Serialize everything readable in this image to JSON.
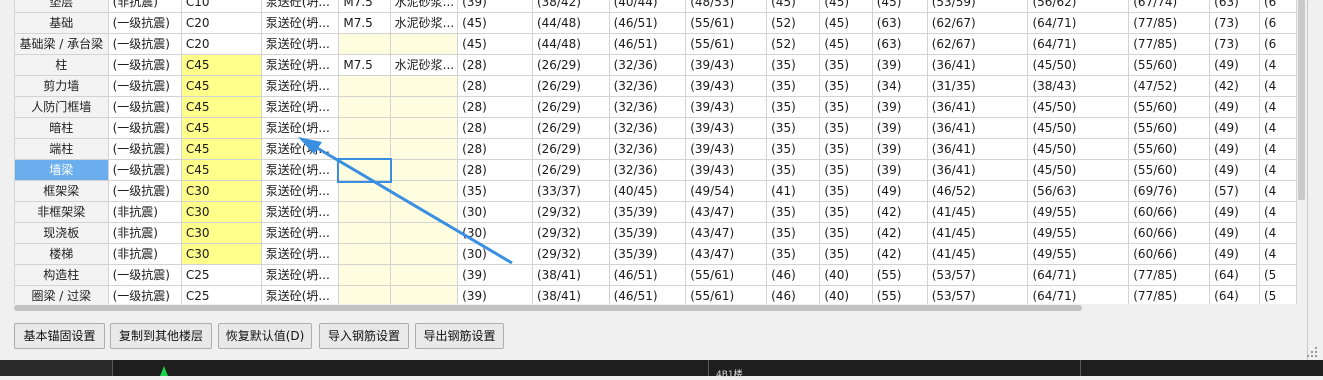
{
  "rows": [
    {
      "name": "垫层",
      "seismic": "(非抗震)",
      "concrete": "C10",
      "pump": "泵送砼(坍...",
      "mortar": "M7.5",
      "mortar_type": "水泥砂浆...",
      "v": [
        "(39)",
        "(38/42)",
        "(40/44)",
        "(48/53)",
        "(45)",
        "(45)",
        "(45)",
        "(53/59)",
        "(56/62)",
        "(67/74)",
        "(63)",
        "(6"
      ]
    },
    {
      "name": "基础",
      "seismic": "(一级抗震)",
      "concrete": "C20",
      "pump": "泵送砼(坍...",
      "mortar": "M7.5",
      "mortar_type": "水泥砂浆...",
      "v": [
        "(45)",
        "(44/48)",
        "(46/51)",
        "(55/61)",
        "(52)",
        "(45)",
        "(63)",
        "(62/67)",
        "(64/71)",
        "(77/85)",
        "(73)",
        "(6"
      ]
    },
    {
      "name": "基础梁 / 承台梁",
      "seismic": "(一级抗震)",
      "concrete": "C20",
      "pump": "泵送砼(坍...",
      "mortar": "",
      "mortar_type": "",
      "v": [
        "(45)",
        "(44/48)",
        "(46/51)",
        "(55/61)",
        "(52)",
        "(45)",
        "(63)",
        "(62/67)",
        "(64/71)",
        "(77/85)",
        "(73)",
        "(6"
      ]
    },
    {
      "name": "柱",
      "seismic": "(一级抗震)",
      "concrete": "C45",
      "pump": "泵送砼(坍...",
      "mortar": "M7.5",
      "mortar_type": "水泥砂浆...",
      "v": [
        "(28)",
        "(26/29)",
        "(32/36)",
        "(39/43)",
        "(35)",
        "(35)",
        "(39)",
        "(36/41)",
        "(45/50)",
        "(55/60)",
        "(49)",
        "(4"
      ]
    },
    {
      "name": "剪力墙",
      "seismic": "(一级抗震)",
      "concrete": "C45",
      "pump": "泵送砼(坍...",
      "mortar": "",
      "mortar_type": "",
      "v": [
        "(28)",
        "(26/29)",
        "(32/36)",
        "(39/43)",
        "(35)",
        "(35)",
        "(34)",
        "(31/35)",
        "(38/43)",
        "(47/52)",
        "(42)",
        "(4"
      ]
    },
    {
      "name": "人防门框墙",
      "seismic": "(一级抗震)",
      "concrete": "C45",
      "pump": "泵送砼(坍...",
      "mortar": "",
      "mortar_type": "",
      "v": [
        "(28)",
        "(26/29)",
        "(32/36)",
        "(39/43)",
        "(35)",
        "(35)",
        "(39)",
        "(36/41)",
        "(45/50)",
        "(55/60)",
        "(49)",
        "(4"
      ]
    },
    {
      "name": "暗柱",
      "seismic": "(一级抗震)",
      "concrete": "C45",
      "pump": "泵送砼(坍...",
      "mortar": "",
      "mortar_type": "",
      "v": [
        "(28)",
        "(26/29)",
        "(32/36)",
        "(39/43)",
        "(35)",
        "(35)",
        "(39)",
        "(36/41)",
        "(45/50)",
        "(55/60)",
        "(49)",
        "(4"
      ]
    },
    {
      "name": "端柱",
      "seismic": "(一级抗震)",
      "concrete": "C45",
      "pump": "泵送砼(坍...",
      "mortar": "",
      "mortar_type": "",
      "v": [
        "(28)",
        "(26/29)",
        "(32/36)",
        "(39/43)",
        "(35)",
        "(35)",
        "(39)",
        "(36/41)",
        "(45/50)",
        "(55/60)",
        "(49)",
        "(4"
      ]
    },
    {
      "name": "墙梁",
      "seismic": "(一级抗震)",
      "concrete": "C45",
      "pump": "泵送砼(坍...",
      "mortar": "",
      "mortar_type": "",
      "v": [
        "(28)",
        "(26/29)",
        "(32/36)",
        "(39/43)",
        "(35)",
        "(35)",
        "(39)",
        "(36/41)",
        "(45/50)",
        "(55/60)",
        "(49)",
        "(4"
      ],
      "selected": true
    },
    {
      "name": "框架梁",
      "seismic": "(一级抗震)",
      "concrete": "C30",
      "pump": "泵送砼(坍...",
      "mortar": "",
      "mortar_type": "",
      "v": [
        "(35)",
        "(33/37)",
        "(40/45)",
        "(49/54)",
        "(41)",
        "(35)",
        "(49)",
        "(46/52)",
        "(56/63)",
        "(69/76)",
        "(57)",
        "(4"
      ]
    },
    {
      "name": "非框架梁",
      "seismic": "(非抗震)",
      "concrete": "C30",
      "pump": "泵送砼(坍...",
      "mortar": "",
      "mortar_type": "",
      "v": [
        "(30)",
        "(29/32)",
        "(35/39)",
        "(43/47)",
        "(35)",
        "(35)",
        "(42)",
        "(41/45)",
        "(49/55)",
        "(60/66)",
        "(49)",
        "(4"
      ]
    },
    {
      "name": "现浇板",
      "seismic": "(非抗震)",
      "concrete": "C30",
      "pump": "泵送砼(坍...",
      "mortar": "",
      "mortar_type": "",
      "v": [
        "(30)",
        "(29/32)",
        "(35/39)",
        "(43/47)",
        "(35)",
        "(35)",
        "(42)",
        "(41/45)",
        "(49/55)",
        "(60/66)",
        "(49)",
        "(4"
      ]
    },
    {
      "name": "楼梯",
      "seismic": "(非抗震)",
      "concrete": "C30",
      "pump": "泵送砼(坍...",
      "mortar": "",
      "mortar_type": "",
      "v": [
        "(30)",
        "(29/32)",
        "(35/39)",
        "(43/47)",
        "(35)",
        "(35)",
        "(42)",
        "(41/45)",
        "(49/55)",
        "(60/66)",
        "(49)",
        "(4"
      ]
    },
    {
      "name": "构造柱",
      "seismic": "(一级抗震)",
      "concrete": "C25",
      "pump": "泵送砼(坍...",
      "mortar": "",
      "mortar_type": "",
      "v": [
        "(39)",
        "(38/41)",
        "(46/51)",
        "(55/61)",
        "(46)",
        "(40)",
        "(55)",
        "(53/57)",
        "(64/71)",
        "(77/85)",
        "(64)",
        "(5"
      ]
    },
    {
      "name": "圈梁 / 过梁",
      "seismic": "(一级抗震)",
      "concrete": "C25",
      "pump": "泵送砼(坍...",
      "mortar": "",
      "mortar_type": "",
      "v": [
        "(39)",
        "(38/41)",
        "(46/51)",
        "(55/61)",
        "(46)",
        "(40)",
        "(55)",
        "(53/57)",
        "(64/71)",
        "(77/85)",
        "(64)",
        "(5"
      ]
    }
  ],
  "buttons": {
    "basic_anchor": "基本锚固设置",
    "copy_floors": "复制到其他楼层",
    "restore_default": "恢复默认值(D)",
    "import_rebar": "导入钢筋设置",
    "export_rebar": "导出钢筋设置"
  },
  "status": {
    "bottom_label": "4B1楼"
  },
  "colors": {
    "yellow": "#ffff8c",
    "light_yellow": "#fffde0",
    "selected_header": "#6aaeee",
    "arrow": "#3a8fe0"
  }
}
